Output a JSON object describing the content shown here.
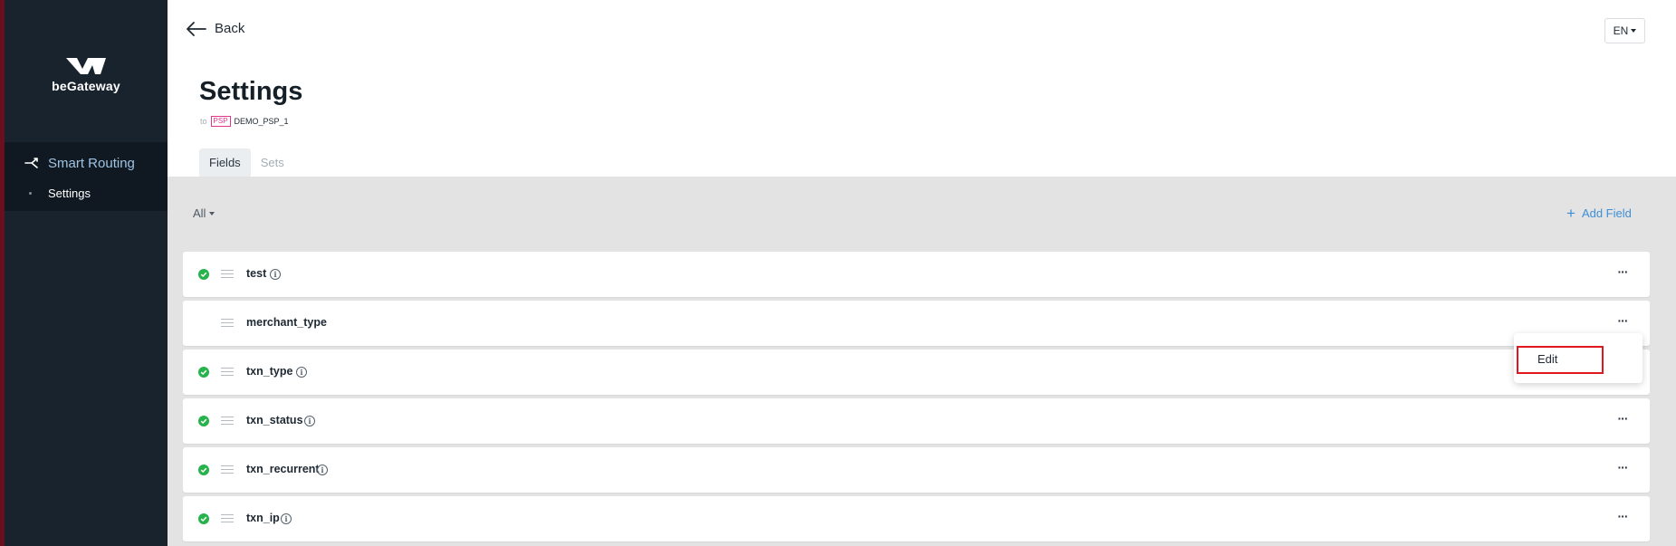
{
  "brand": {
    "name": "beGateway"
  },
  "sidebar": {
    "section_label": "Smart Routing",
    "items": [
      {
        "label": "Settings"
      }
    ]
  },
  "header": {
    "back_label": "Back",
    "language": "EN"
  },
  "page": {
    "title": "Settings",
    "to_label": "to",
    "psp_badge": "PSP",
    "psp_name": "DEMO_PSP_1"
  },
  "tabs": [
    {
      "label": "Fields",
      "active": true
    },
    {
      "label": "Sets",
      "active": false
    }
  ],
  "toolbar": {
    "filter_label": "All",
    "add_field_label": "Add Field"
  },
  "fields": [
    {
      "name": "test",
      "active": true,
      "info": true
    },
    {
      "name": "merchant_type",
      "active": false,
      "info": false
    },
    {
      "name": "txn_type",
      "active": true,
      "info": true
    },
    {
      "name": "txn_status",
      "active": true,
      "info": true
    },
    {
      "name": "txn_recurrent",
      "active": true,
      "info": true
    },
    {
      "name": "txn_ip",
      "active": true,
      "info": true
    }
  ],
  "context_menu": {
    "edit_label": "Edit"
  },
  "colors": {
    "sidebar_bg": "#18232e",
    "accent": "#3d8fd6",
    "active_check": "#27b34b",
    "psp_badge": "#e2368a",
    "highlight": "#e0171f"
  }
}
